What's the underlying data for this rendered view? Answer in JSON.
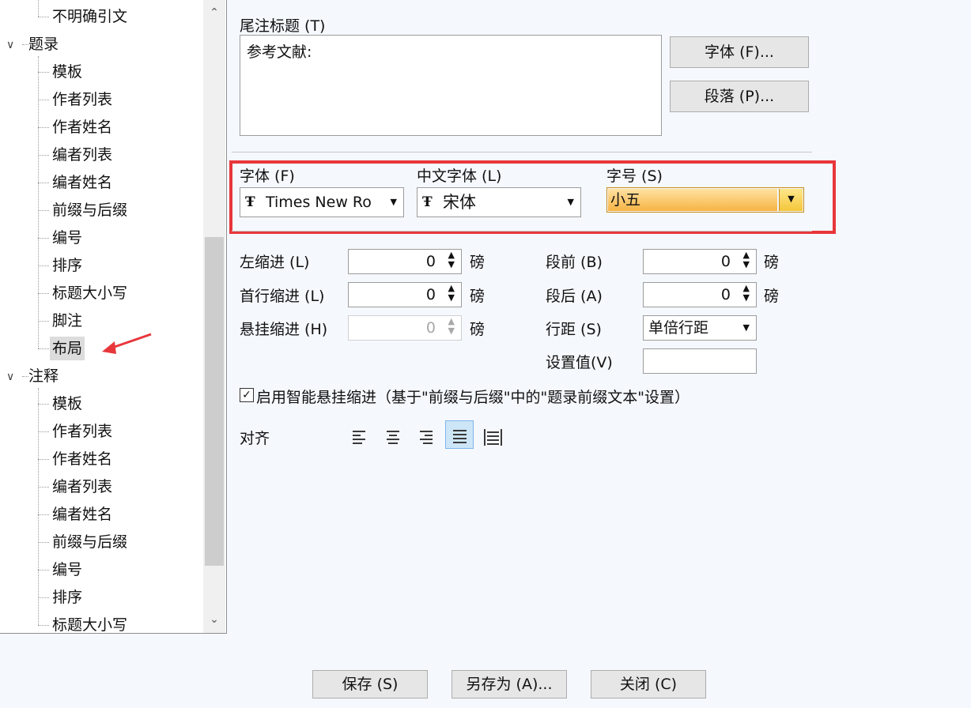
{
  "tree": {
    "items": [
      {
        "label": "不明确引文",
        "level": 2
      },
      {
        "label": "题录",
        "level": 1
      },
      {
        "label": "模板",
        "level": 2
      },
      {
        "label": "作者列表",
        "level": 2
      },
      {
        "label": "作者姓名",
        "level": 2
      },
      {
        "label": "编者列表",
        "level": 2
      },
      {
        "label": "编者姓名",
        "level": 2
      },
      {
        "label": "前缀与后缀",
        "level": 2
      },
      {
        "label": "编号",
        "level": 2
      },
      {
        "label": "排序",
        "level": 2
      },
      {
        "label": "标题大小写",
        "level": 2
      },
      {
        "label": "脚注",
        "level": 2
      },
      {
        "label": "布局",
        "level": 2,
        "selected": true
      },
      {
        "label": "注释",
        "level": 1
      },
      {
        "label": "模板",
        "level": 2
      },
      {
        "label": "作者列表",
        "level": 2
      },
      {
        "label": "作者姓名",
        "level": 2
      },
      {
        "label": "编者列表",
        "level": 2
      },
      {
        "label": "编者姓名",
        "level": 2
      },
      {
        "label": "前缀与后缀",
        "level": 2
      },
      {
        "label": "编号",
        "level": 2
      },
      {
        "label": "排序",
        "level": 2
      },
      {
        "label": "标题大小写",
        "level": 2
      }
    ]
  },
  "endnote": {
    "title_label": "尾注标题 (T)",
    "title_value": "参考文献:",
    "font_button": "字体 (F)...",
    "para_button": "段落 (P)..."
  },
  "font": {
    "font_label": "字体 (F)",
    "font_value": "Times New Ro",
    "cn_font_label": "中文字体 (L)",
    "cn_font_value": "宋体",
    "size_label": "字号 (S)",
    "size_value": "小五"
  },
  "indent": {
    "left_label": "左缩进 (L)",
    "left_value": "0",
    "first_label": "首行缩进 (L)",
    "first_value": "0",
    "hang_label": "悬挂缩进 (H)",
    "hang_value": "0",
    "unit": "磅",
    "before_label": "段前 (B)",
    "before_value": "0",
    "after_label": "段后 (A)",
    "after_value": "0",
    "spacing_label": "行距 (S)",
    "spacing_value": "单倍行距",
    "setval_label": "设置值(V)",
    "setval_value": ""
  },
  "smart_indent": {
    "checked": true,
    "label": "启用智能悬挂缩进（基于\"前缀与后缀\"中的\"题录前缀文本\"设置）"
  },
  "align": {
    "label": "对齐",
    "options": [
      "align-left",
      "align-center",
      "align-right",
      "align-justify",
      "align-distributed"
    ],
    "selected": "align-justify"
  },
  "footer": {
    "save": "保存 (S)",
    "save_as": "另存为 (A)...",
    "close": "关闭 (C)"
  },
  "colors": {
    "highlight_box": "#e8373b",
    "size_field_start": "#ffd27a",
    "size_field_end": "#f5a623",
    "annotation_arrow": "#e8373b"
  }
}
